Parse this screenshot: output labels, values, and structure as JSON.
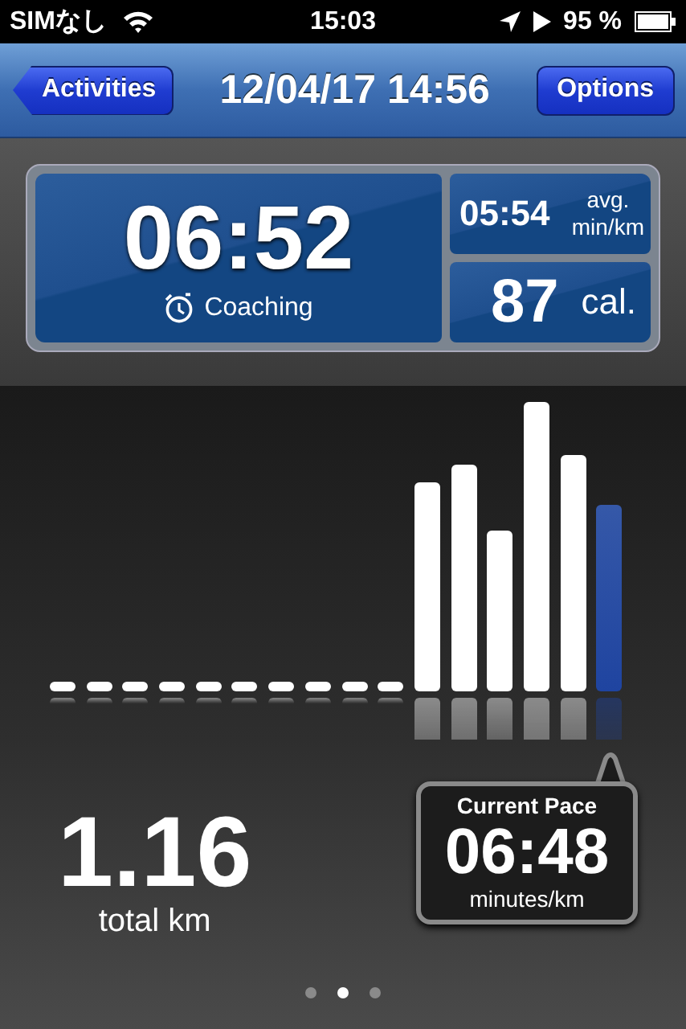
{
  "status_bar": {
    "carrier": "SIMなし",
    "time": "15:03",
    "battery": "95 %"
  },
  "nav_bar": {
    "back_button": "Activities",
    "title": "12/04/17 14:56",
    "right_button": "Options"
  },
  "summary": {
    "duration": "06:52",
    "coaching": "Coaching",
    "avg_pace": "05:54",
    "avg_label": "avg.",
    "avg_unit": "min/km",
    "calories": "87",
    "calories_unit": "cal."
  },
  "pace_bars": [
    {
      "selected": false
    },
    {
      "selected": false
    },
    {
      "selected": false
    },
    {
      "selected": false
    },
    {
      "selected": false
    },
    {
      "selected": false
    },
    {
      "selected": false
    },
    {
      "selected": false
    },
    {
      "selected": false
    },
    {
      "selected": false
    },
    {
      "selected": false
    },
    {
      "selected": false
    },
    {
      "selected": false
    },
    {
      "selected": false
    },
    {
      "selected": false
    },
    {
      "selected": true
    }
  ],
  "distance": {
    "value": "1.16",
    "unit": "total km"
  },
  "current_pace": {
    "title": "Current Pace",
    "value": "06:48",
    "unit": "minutes/km"
  },
  "page_dots": [
    {
      "selected": false
    },
    {
      "selected": true
    },
    {
      "selected": false
    }
  ]
}
